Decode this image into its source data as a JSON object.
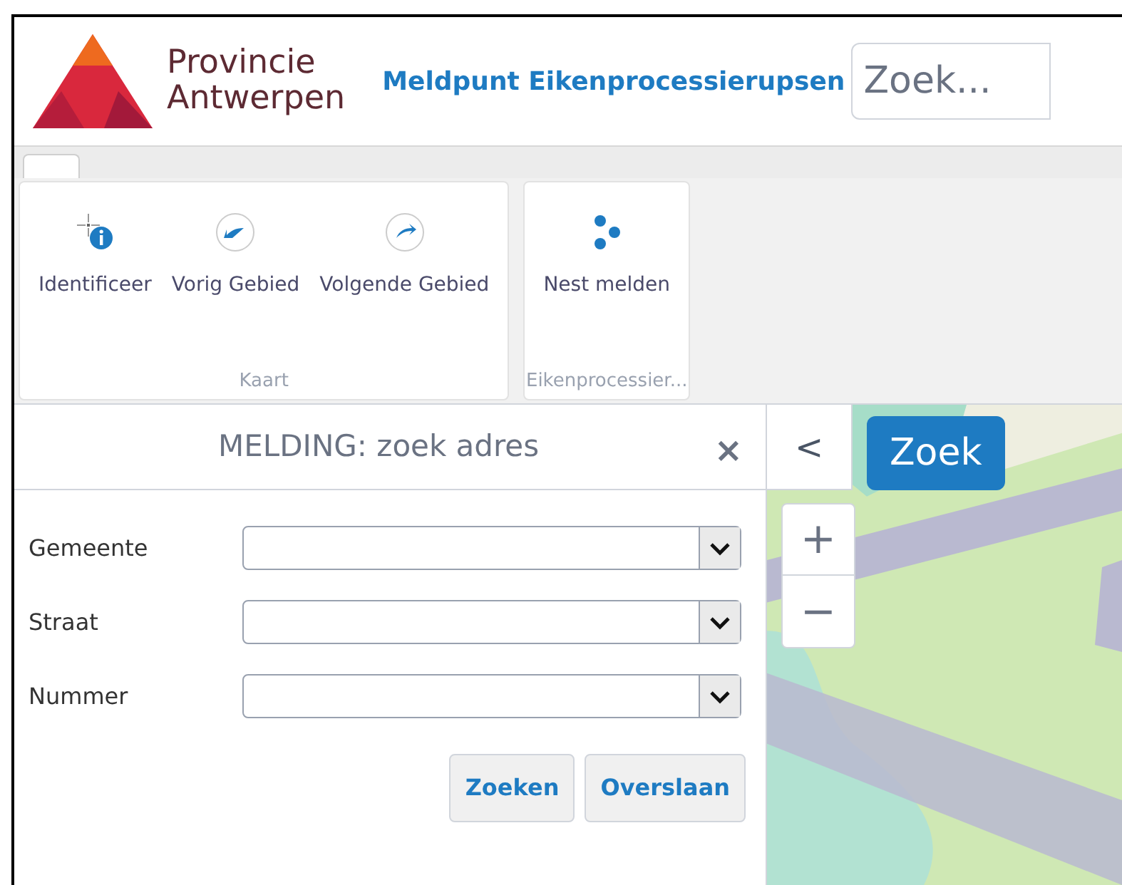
{
  "header": {
    "logo_line_1": "Provincie",
    "logo_line_2": "Antwerpen",
    "title": "Meldpunt Eikenprocessierupsen",
    "search": {
      "placeholder": "Zoek..."
    }
  },
  "tabs": [
    {
      "selected": true
    }
  ],
  "ribbon": {
    "groups": [
      {
        "label": "Kaart",
        "items": [
          {
            "kind": "identify",
            "label": "Identificeer"
          },
          {
            "kind": "back",
            "label": "Vorig Gebied"
          },
          {
            "kind": "forward",
            "label": "Volgende Gebied"
          }
        ]
      },
      {
        "label": "Eikenprocessier...",
        "items": [
          {
            "kind": "dots",
            "label": "Nest melden"
          }
        ]
      }
    ]
  },
  "panel": {
    "title": "MELDING: zoek adres",
    "close": "×",
    "fields": [
      {
        "label": "Gemeente"
      },
      {
        "label": "Straat"
      },
      {
        "label": "Nummer"
      }
    ],
    "buttons": [
      "Zoeken",
      "Overslaan"
    ]
  },
  "map": {
    "collapse": "<",
    "search_button": "Zoek",
    "zoom_in": "+",
    "zoom_out": "−"
  }
}
